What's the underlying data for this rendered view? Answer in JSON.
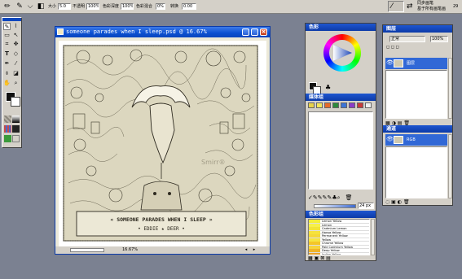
{
  "options_bar": {
    "size_label": "大小",
    "size_value": "5.0",
    "opacity_label": "不透明",
    "opacity_value": "100%",
    "color_depth_label": "色彩深度",
    "color_depth_value": "100%",
    "color_blend_label": "色彩混合",
    "color_blend_value": "0%",
    "angle_label": "转换",
    "angle_value": "0.00",
    "right_text_1": "同步画笔",
    "right_text_2": "基于所有画笔画",
    "right_num": "29"
  },
  "document": {
    "title": "someone parades when I sleep.psd @ 16.67%",
    "zoom": "16.67%",
    "caption_line1": "« SOMEONE PARADES WHEN I SLEEP »",
    "caption_line2": "• EDDIE ★ DEER •",
    "watermark": "Smirr®"
  },
  "color_panel": {
    "title": "色彩",
    "accent": "#1e56d0"
  },
  "brush_panel": {
    "title": "媒体组",
    "swatches": [
      "#e8d24a",
      "#f2e65c",
      "#e66a28",
      "#2d8a3c",
      "#3c74d6",
      "#8a3cc8",
      "#c83a3a",
      "#f0f0f0"
    ],
    "size_value": "24 px"
  },
  "color_set_panel": {
    "title": "色彩组",
    "items": [
      {
        "name": "Lemon Yellow",
        "color": "#f4ee38"
      },
      {
        "name": "Lemon",
        "color": "#f6f04a"
      },
      {
        "name": "Cadmium Lemon",
        "color": "#f2e438"
      },
      {
        "name": "Hansa Yellow",
        "color": "#f6e23c"
      },
      {
        "name": "Permanent Yellow",
        "color": "#f4d838"
      },
      {
        "name": "Yellow",
        "color": "#f6e440"
      },
      {
        "name": "Chrome Yellow",
        "color": "#f4c628"
      },
      {
        "name": "Pale Cadmium Yellow",
        "color": "#f6d43c"
      },
      {
        "name": "Deep Yellow",
        "color": "#f0b428"
      },
      {
        "name": "Indian Yellow",
        "color": "#e8a02a"
      }
    ]
  },
  "layers_panel": {
    "title": "图层",
    "blend": "正常",
    "opacity": "100%",
    "layer_name": "图层",
    "accent": "#3168d6"
  },
  "channels_panel": {
    "title": "通道",
    "channel_name": "RGB"
  }
}
